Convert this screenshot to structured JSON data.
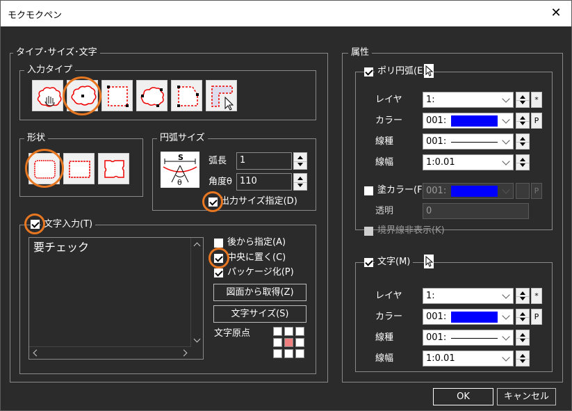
{
  "window": {
    "title": "モクモクペン",
    "close_glyph": "✕"
  },
  "left_group": {
    "legend": "タイプ･サイズ･文字"
  },
  "input_type": {
    "legend": "入力タイプ",
    "buttons": [
      "freehand-hand",
      "circle-point",
      "rect-points",
      "cloud-selection",
      "polygon-points",
      "polyline-arrow"
    ]
  },
  "shape": {
    "legend": "形状"
  },
  "arc_size": {
    "legend": "円弧サイズ",
    "diagram_s": "S",
    "diagram_theta": "θ",
    "arc_length_label": "弧長",
    "arc_length_value": "1",
    "angle_label": "角度θ",
    "angle_value": "110",
    "output_size_label": "出力サイズ指定(D)",
    "output_size_checked": true
  },
  "text_input": {
    "legend": "文字入力(T)",
    "checked": true,
    "text_value": "要チェック",
    "specify_later_label": "後から指定(A)",
    "specify_later_checked": false,
    "center_label": "中央に置く(C)",
    "center_checked": true,
    "package_label": "パッケージ化(P)",
    "package_checked": true,
    "get_from_drawing_label": "図面から取得(Z)",
    "text_size_label": "文字サイズ(S)",
    "origin_label": "文字原点",
    "origin_selected": "center"
  },
  "attributes": {
    "legend": "属性",
    "poly_arc": {
      "legend": "ポリ円弧(E)",
      "checked": true,
      "layer_label": "レイヤ",
      "layer_value": "1:",
      "color_label": "カラー",
      "color_value": "001:",
      "color_hex": "#0000ff",
      "linetype_label": "線種",
      "linetype_value": "001:",
      "linewidth_label": "線幅",
      "linewidth_value": "1:0.01",
      "fill_label": "塗カラー(F)",
      "fill_checked": false,
      "fill_value": "001:",
      "transparency_label": "透明",
      "transparency_value": "0",
      "hide_boundary_label": "境界線非表示(K)",
      "hide_boundary_checked": false,
      "star_button": "*",
      "p_button": "P"
    },
    "text": {
      "legend": "文字(M)",
      "checked": true,
      "layer_label": "レイヤ",
      "layer_value": "1:",
      "color_label": "カラー",
      "color_value": "001:",
      "color_hex": "#0000ff",
      "linetype_label": "線種",
      "linetype_value": "001:",
      "linewidth_label": "線幅",
      "linewidth_value": "1:0.01",
      "star_button": "*",
      "p_button": "P"
    }
  },
  "footer": {
    "ok_label": "OK",
    "cancel_label": "キャンセル"
  },
  "highlight_color": "#e87722"
}
